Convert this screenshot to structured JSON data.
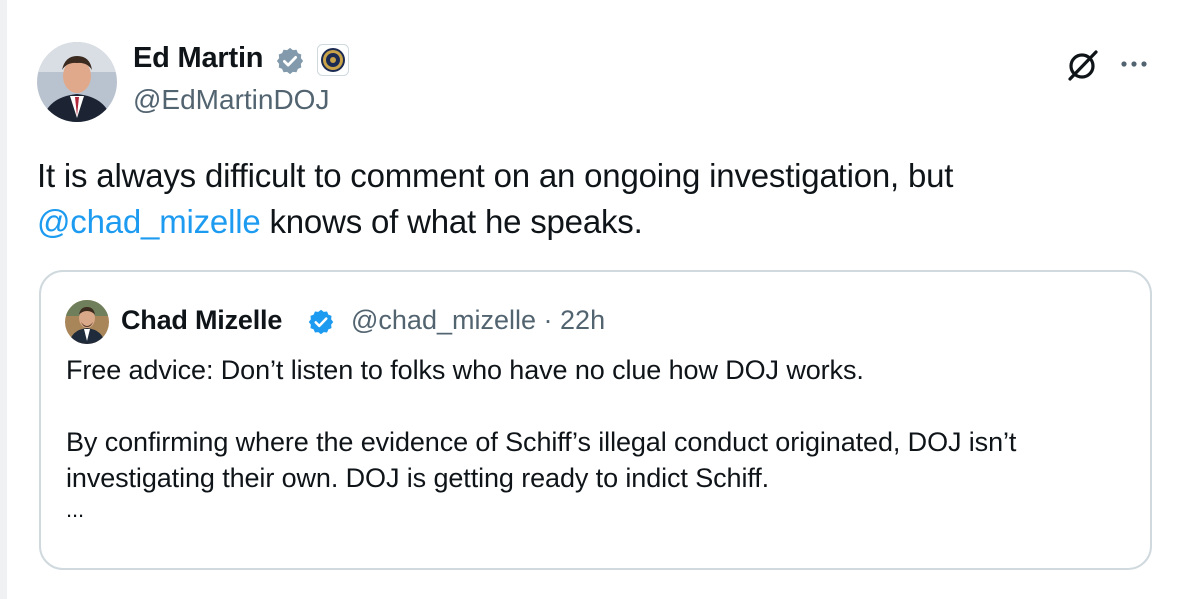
{
  "tweet": {
    "author_name": "Ed Martin",
    "author_handle": "@EdMartinDOJ",
    "text_prefix": "It is always difficult to comment on an ongoing investigation, but",
    "mention": "@chad_mizelle",
    "text_suffix": " knows of what he speaks."
  },
  "quote": {
    "author_name": "Chad Mizelle",
    "author_handle": "@chad_mizelle",
    "separator": "·",
    "time": "22h",
    "paragraph_1": "Free advice: Don’t listen to folks who have no clue how DOJ works.",
    "paragraph_2": "By confirming where the evidence of Schiff’s illegal conduct originated, DOJ isn’t investigating their own. DOJ is getting ready to indict Schiff.",
    "truncation": "..."
  },
  "icons": {
    "verified": "verified-badge-icon",
    "affiliation": "doj-seal-icon",
    "grok": "grok-icon",
    "more": "more-options-icon"
  },
  "colors": {
    "text": "#0f1419",
    "secondary": "#536471",
    "link": "#1d9bf0",
    "border": "#cfd9de",
    "verified": "#1d9bf0"
  }
}
